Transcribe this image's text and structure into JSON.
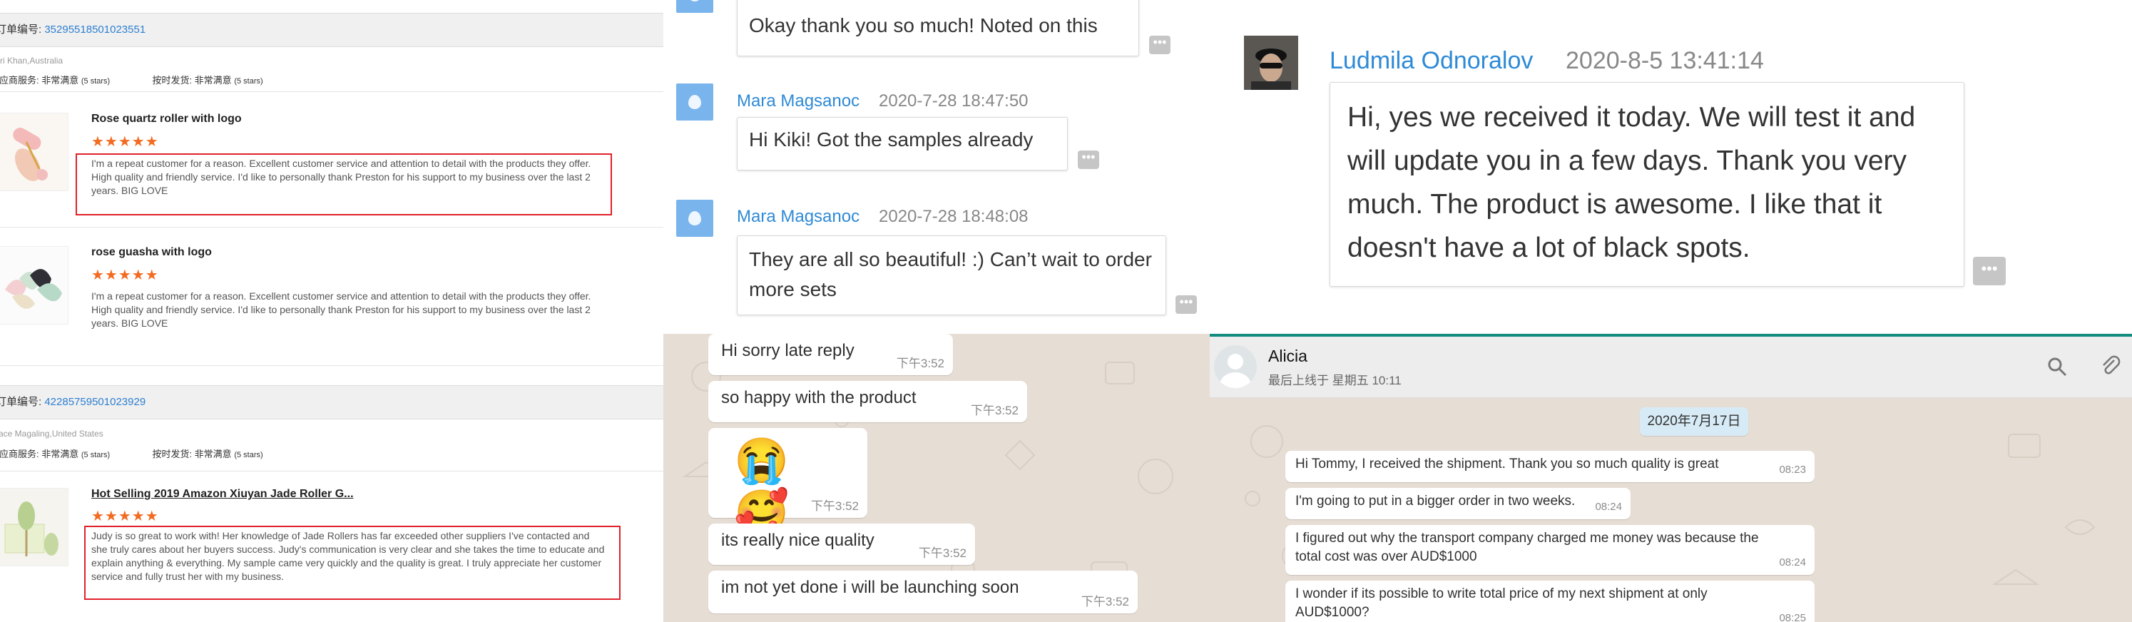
{
  "panel1": {
    "order1": {
      "label": "订单编号:",
      "number": "35295518501023551"
    },
    "buyer1": "ri Khan,Australia",
    "supplier_service_label": "供应商服务: 非常满意",
    "supplier_service_stars": "(5 stars)",
    "delivery_label": "按时发货: 非常满意",
    "delivery_stars": "(5 stars)",
    "item1": {
      "title": "Rose quartz roller with logo",
      "stars": "★★★★★",
      "review": "I'm a repeat customer for a reason. Excellent customer service and attention to detail with the products they offer. High quality and friendly service. I'd like to personally thank Preston for his support to my business over the last 2 years. BIG LOVE"
    },
    "item2": {
      "title": "rose guasha with logo",
      "stars": "★★★★★",
      "review": "I'm a repeat customer for a reason. Excellent customer service and attention to detail with the products they offer. High quality and friendly service. I'd like to personally thank Preston for his support to my business over the last 2 years. BIG LOVE"
    },
    "order2": {
      "label": "订单编号:",
      "number": "42285759501023929"
    },
    "buyer2": "race Magaling,United States",
    "supplier_service_label2": "供应商服务: 非常满意",
    "supplier_service_stars2": "(5 stars)",
    "delivery_label2": "按时发货: 非常满意",
    "delivery_stars2": "(5 stars)",
    "item3": {
      "title": "Hot Selling 2019 Amazon Xiuyan Jade Roller G...",
      "stars": "★★★★★",
      "review": "Judy is so great to work with! Her knowledge of Jade Rollers has far exceeded other suppliers I've contacted and she truly cares about her buyers success. Judy's communication is very clear and she takes the time to educate and explain anything & everything. My sample came very quickly and the quality is great. I truly appreciate her customer service and fully trust her with my business."
    }
  },
  "panel2": {
    "msg0": "Okay thank you so much! Noted on this",
    "msg1": {
      "name": "Mara Magsanoc",
      "time": "2020-7-28 18:47:50",
      "text": "Hi Kiki! Got the samples already"
    },
    "msg2": {
      "name": "Mara Magsanoc",
      "time": "2020-7-28 18:48:08",
      "text": "They are all so beautiful! :) Can’t wait to order more sets"
    },
    "more": "•••"
  },
  "panel3": {
    "name": "Ludmila Odnoralov",
    "time": "2020-8-5 13:41:14",
    "text": "Hi, yes we received it today. We will test it and will update you in a few days. Thank you very much. The product is awesome. I like that it doesn't have a lot of black spots."
  },
  "panel4": {
    "messages": [
      {
        "text": "Hi sorry late reply",
        "time": "下午3:52"
      },
      {
        "text": "so happy with the product",
        "time": "下午3:52"
      },
      {
        "text": "😭🥰",
        "time": "下午3:52"
      },
      {
        "text": "its really nice quality",
        "time": "下午3:52"
      },
      {
        "text": "im not yet done i will be launching soon",
        "time": "下午3:52"
      }
    ]
  },
  "panel5": {
    "contact": "Alicia",
    "status": "最后上线于 星期五 10:11",
    "date_chip": "2020年7月17日",
    "messages": [
      {
        "text": "Hi Tommy, I received the shipment. Thank you so much quality is great",
        "time": "08:23"
      },
      {
        "text": "I'm going to put in a bigger order in two weeks.",
        "time": "08:24"
      },
      {
        "text": "I figured out why the transport company charged me money was because the total cost was over AUD$1000",
        "time": "08:24"
      },
      {
        "text": "I wonder if its possible to write total price of my next shipment at only AUD$1000?",
        "time": "08:25"
      }
    ]
  },
  "colors": {
    "link_blue": "#2d7fd1",
    "highlight_red": "#e0212b",
    "star_orange": "#f26b21",
    "wa_bg": "#e6ddd4",
    "teal_line": "#128c7e"
  },
  "icons": [
    "drop-avatar-icon",
    "search-icon",
    "paperclip-icon",
    "user-avatar-icon"
  ]
}
